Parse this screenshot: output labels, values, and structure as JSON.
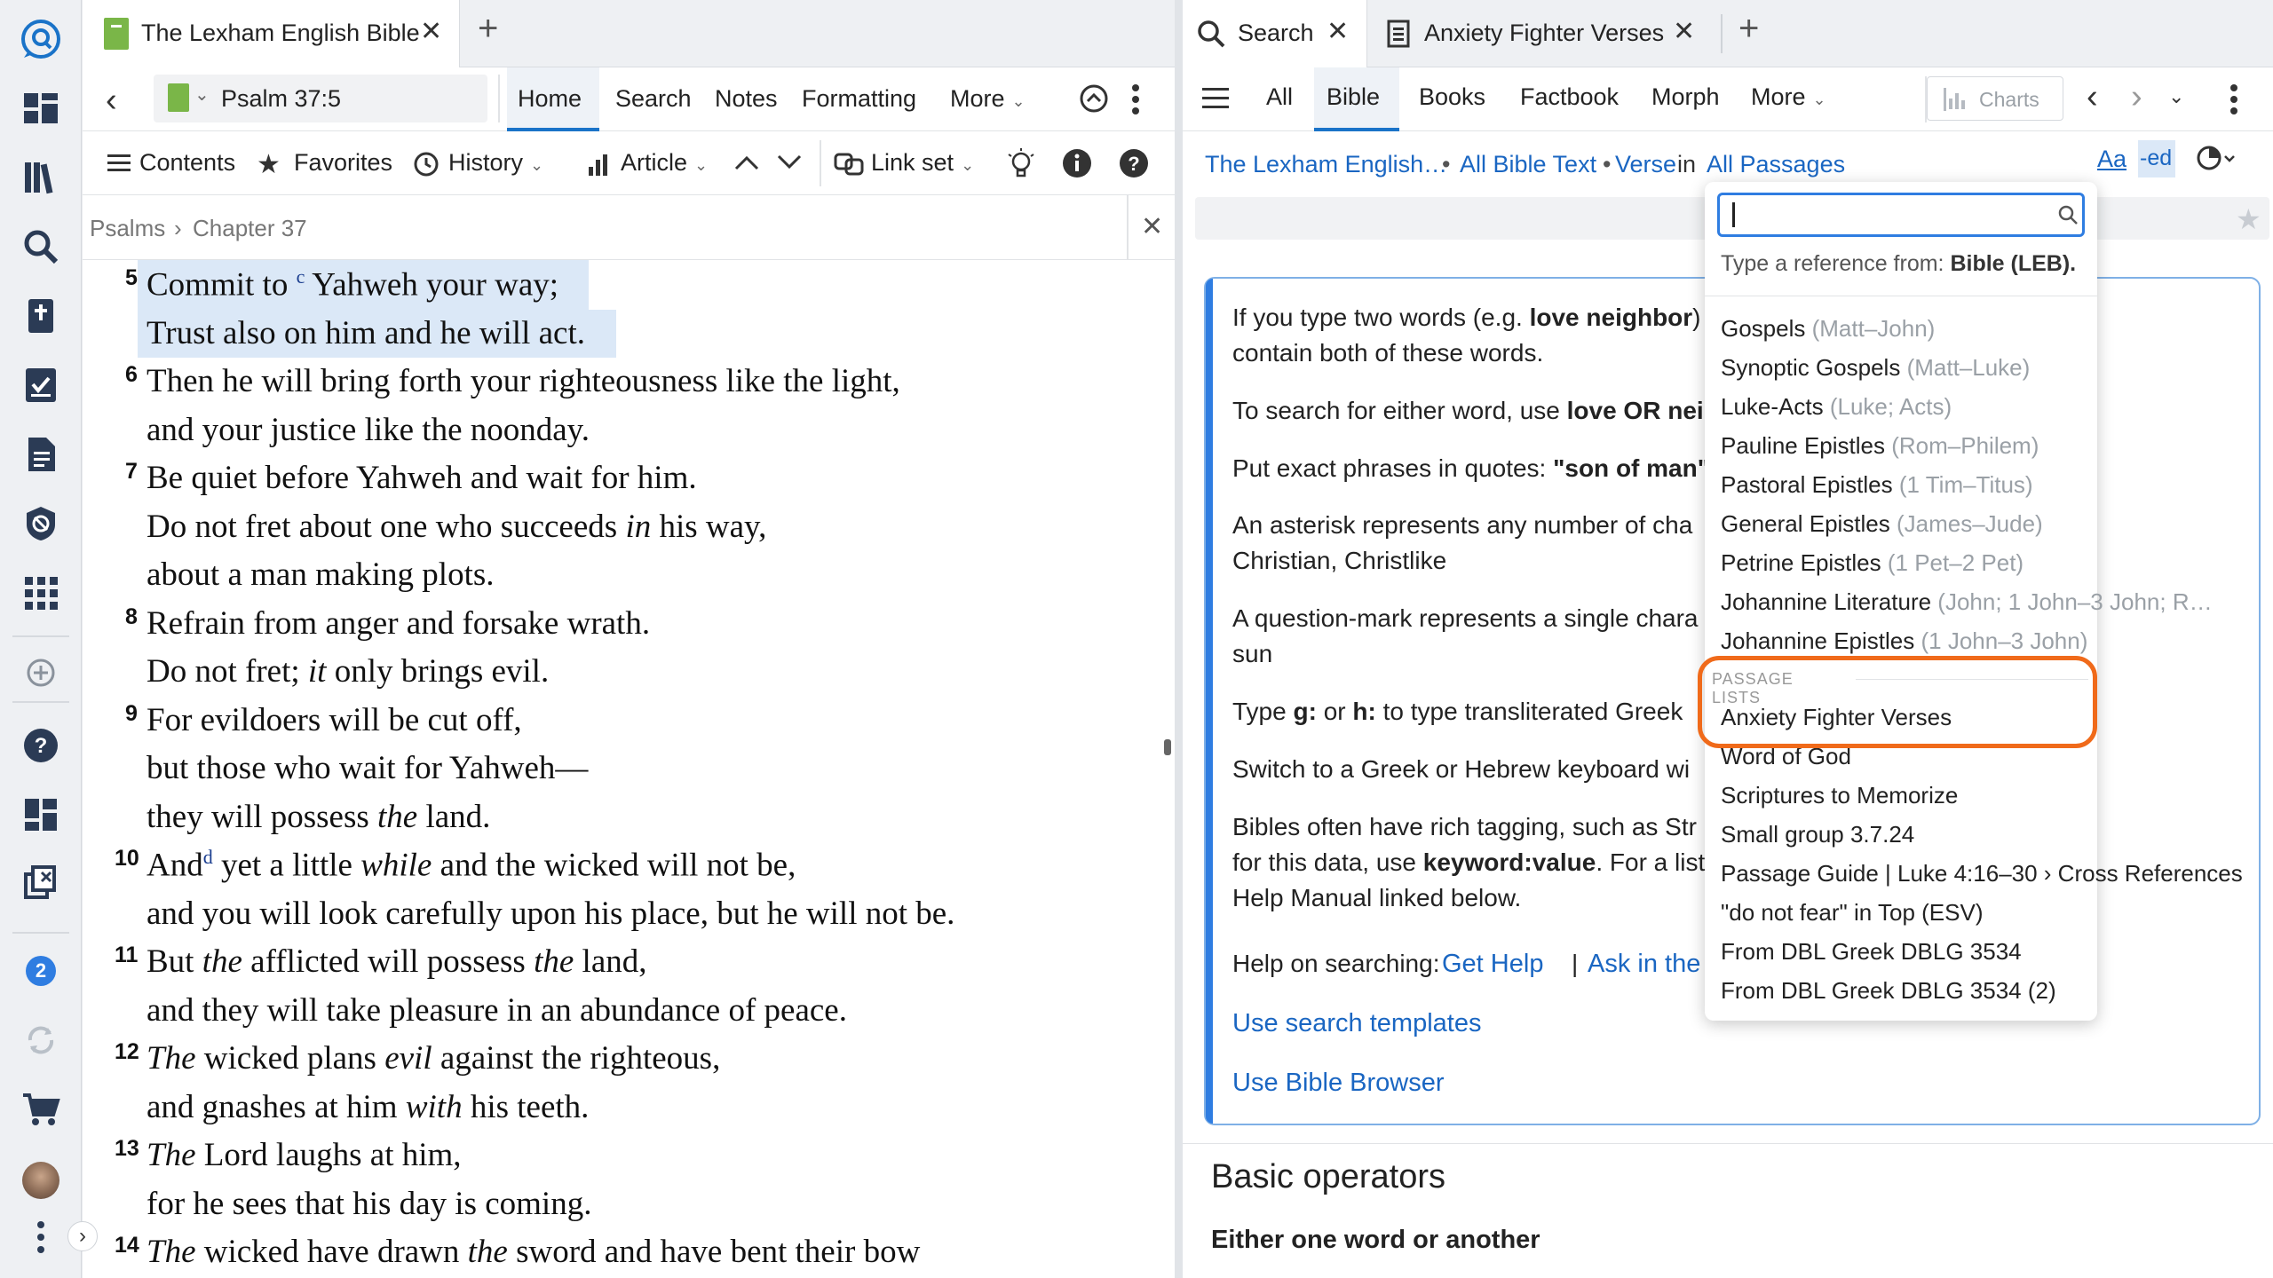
{
  "left_tab": {
    "title": "The Lexham English Bible",
    "close": "✕",
    "add": "+"
  },
  "left_toolbar": {
    "reference": "Psalm 37:5",
    "menu": [
      "Home",
      "Search",
      "Notes",
      "Formatting",
      "More"
    ],
    "row2": [
      "Contents",
      "Favorites",
      "History",
      "Article",
      "Link set"
    ]
  },
  "breadcrumb": {
    "part1": "Psalms",
    "sep": "›",
    "part2": "Chapter 37",
    "close": "✕"
  },
  "verses": [
    {
      "num": "5",
      "lines": [
        {
          "parts": [
            {
              "t": "Commit to "
            },
            {
              "t": "c",
              "sup": true
            },
            {
              "t": " Yahweh your way;"
            }
          ]
        },
        {
          "parts": [
            {
              "t": "Trust also on him and he will act."
            }
          ]
        }
      ]
    },
    {
      "num": "6",
      "lines": [
        {
          "parts": [
            {
              "t": "Then he will bring forth your righteousness like the light,"
            }
          ]
        },
        {
          "parts": [
            {
              "t": "and your justice like the noonday."
            }
          ]
        }
      ]
    },
    {
      "num": "7",
      "lines": [
        {
          "parts": [
            {
              "t": "Be quiet before Yahweh and wait for him."
            }
          ]
        },
        {
          "parts": [
            {
              "t": "Do not fret about one who succeeds "
            },
            {
              "t": "in",
              "i": true
            },
            {
              "t": " his way,"
            }
          ]
        },
        {
          "parts": [
            {
              "t": "about a man making plots."
            }
          ]
        }
      ]
    },
    {
      "num": "8",
      "lines": [
        {
          "parts": [
            {
              "t": "Refrain from anger and forsake wrath."
            }
          ]
        },
        {
          "parts": [
            {
              "t": "Do not fret; "
            },
            {
              "t": "it",
              "i": true
            },
            {
              "t": " only brings evil."
            }
          ]
        }
      ]
    },
    {
      "num": "9",
      "lines": [
        {
          "parts": [
            {
              "t": "For evildoers will be cut off,"
            }
          ]
        },
        {
          "parts": [
            {
              "t": "but those who wait for Yahweh—"
            }
          ]
        },
        {
          "parts": [
            {
              "t": "they will possess "
            },
            {
              "t": "the",
              "i": true
            },
            {
              "t": " land."
            }
          ]
        }
      ]
    },
    {
      "num": "10",
      "lines": [
        {
          "parts": [
            {
              "t": "And"
            },
            {
              "t": "d",
              "sup": true
            },
            {
              "t": " yet a little "
            },
            {
              "t": "while",
              "i": true
            },
            {
              "t": " and the wicked will not be,"
            }
          ]
        },
        {
          "parts": [
            {
              "t": "and you will look carefully upon his place, but he will not be."
            }
          ]
        }
      ]
    },
    {
      "num": "11",
      "lines": [
        {
          "parts": [
            {
              "t": "But "
            },
            {
              "t": "the",
              "i": true
            },
            {
              "t": " afflicted will possess "
            },
            {
              "t": "the",
              "i": true
            },
            {
              "t": " land,"
            }
          ]
        },
        {
          "parts": [
            {
              "t": "and they will take pleasure in an abundance of peace."
            }
          ]
        }
      ]
    },
    {
      "num": "12",
      "lines": [
        {
          "parts": [
            {
              "t": "The",
              "i": true
            },
            {
              "t": " wicked plans "
            },
            {
              "t": "evil",
              "i": true
            },
            {
              "t": " against the righteous,"
            }
          ]
        },
        {
          "parts": [
            {
              "t": "and gnashes at him "
            },
            {
              "t": "with",
              "i": true
            },
            {
              "t": " his teeth."
            }
          ]
        }
      ]
    },
    {
      "num": "13",
      "lines": [
        {
          "parts": [
            {
              "t": "The",
              "i": true
            },
            {
              "t": " Lord laughs at him,"
            }
          ]
        },
        {
          "parts": [
            {
              "t": "for he sees that his day is coming."
            }
          ]
        }
      ]
    },
    {
      "num": "14",
      "lines": [
        {
          "parts": [
            {
              "t": "The",
              "i": true
            },
            {
              "t": " wicked have drawn "
            },
            {
              "t": "the",
              "i": true
            },
            {
              "t": " sword and have bent their bow"
            }
          ]
        }
      ]
    }
  ],
  "right_tabs": {
    "search": "Search",
    "list": "Anxiety Fighter Verses",
    "close": "✕",
    "add": "+"
  },
  "right_toolbar": {
    "menu": [
      "All",
      "Bible",
      "Books",
      "Factbook",
      "Morph",
      "More"
    ],
    "charts": "Charts"
  },
  "search_scope": {
    "resource": "The Lexham English…",
    "bullet": "•",
    "text_scope": "All Bible Text",
    "unit": "Verse",
    "in": "in",
    "range": "All Passages",
    "aa": "Aa",
    "ed": "-ed"
  },
  "help": {
    "lines": [
      [
        {
          "t": "If you type two words (e.g. "
        },
        {
          "t": "love neighbor",
          "b": true
        },
        {
          "t": ") "
        }
      ],
      [
        {
          "t": "contain both of these words."
        }
      ],
      [
        {
          "t": "To search for either word, use "
        },
        {
          "t": "love OR nei",
          "b": true
        }
      ],
      [
        {
          "t": "Put exact phrases in quotes: "
        },
        {
          "t": "\"son of man\"",
          "b": true
        }
      ],
      [
        {
          "t": "An asterisk represents any number of cha"
        }
      ],
      [
        {
          "t": "Christian, Christlike"
        }
      ],
      [
        {
          "t": "A question-mark represents a single chara"
        }
      ],
      [
        {
          "t": "sun"
        }
      ],
      [
        {
          "t": "Type "
        },
        {
          "t": "g:",
          "b": true
        },
        {
          "t": " or "
        },
        {
          "t": "h:",
          "b": true
        },
        {
          "t": " to type transliterated Greek"
        }
      ],
      [
        {
          "t": "Switch to a Greek or Hebrew keyboard wi"
        }
      ],
      [
        {
          "t": "Bibles often have rich tagging, such as Str"
        }
      ],
      [
        {
          "t": "for this data, use "
        },
        {
          "t": "keyword:value",
          "b": true
        },
        {
          "t": ". For a list"
        }
      ],
      [
        {
          "t": "Help Manual linked below."
        }
      ]
    ],
    "help_label": "Help on searching:",
    "get_help": "Get Help",
    "pipe": "|",
    "ask": "Ask in the Se",
    "templates": "Use search templates",
    "browser": "Use Bible Browser",
    "basic_operators": "Basic operators",
    "either": "Either one word or another"
  },
  "dropdown": {
    "prompt_prefix": "Type a reference from: ",
    "prompt_bold": "Bible (LEB).",
    "ranges": [
      {
        "name": "Gospels",
        "range": "(Matt–John)"
      },
      {
        "name": "Synoptic Gospels",
        "range": "(Matt–Luke)"
      },
      {
        "name": "Luke-Acts",
        "range": "(Luke; Acts)"
      },
      {
        "name": "Pauline Epistles",
        "range": "(Rom–Philem)"
      },
      {
        "name": "Pastoral Epistles",
        "range": "(1 Tim–Titus)"
      },
      {
        "name": "General Epistles",
        "range": "(James–Jude)"
      },
      {
        "name": "Petrine Epistles",
        "range": "(1 Pet–2 Pet)"
      },
      {
        "name": "Johannine Literature",
        "range": "(John; 1 John–3 John; R…"
      },
      {
        "name": "Johannine Epistles",
        "range": "(1 John–3 John)"
      }
    ],
    "section_label": "PASSAGE LISTS",
    "lists": [
      "Anxiety Fighter Verses",
      "Word of God",
      "Scriptures to Memorize",
      "Small group 3.7.24",
      "Passage Guide | Luke 4:16–30 › Cross References",
      "\"do not fear\" in Top (ESV)",
      "From DBL Greek DBLG 3534",
      "From DBL Greek DBLG 3534 (2)"
    ],
    "highlight_color": "#f06a1a"
  },
  "rail": {
    "badge": "2",
    "expand": "›"
  },
  "colors": {
    "accent": "#1a73c8",
    "link": "#1a66c2",
    "highlight": "#dbe8f7",
    "orange": "#f06a1a"
  }
}
